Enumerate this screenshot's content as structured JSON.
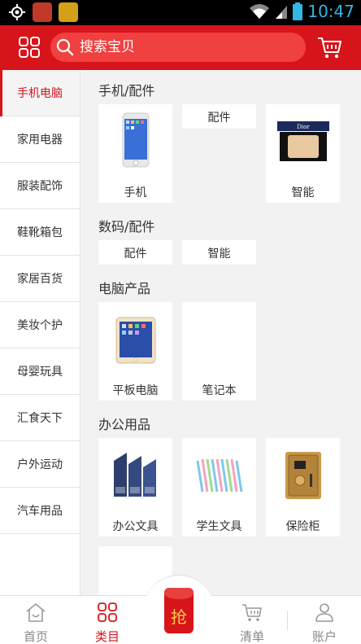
{
  "status_bar": {
    "time": "10:47"
  },
  "header": {
    "search_placeholder": "搜索宝贝"
  },
  "sidebar": {
    "items": [
      {
        "label": "手机电脑"
      },
      {
        "label": "家用电器"
      },
      {
        "label": "服装配饰"
      },
      {
        "label": "鞋靴箱包"
      },
      {
        "label": "家居百货"
      },
      {
        "label": "美妆个护"
      },
      {
        "label": "母婴玩具"
      },
      {
        "label": "汇食天下"
      },
      {
        "label": "户外运动"
      },
      {
        "label": "汽车用品"
      }
    ],
    "active_index": 0
  },
  "sections": [
    {
      "title": "手机/配件",
      "tiles": [
        {
          "label": "手机"
        },
        {
          "label": "配件"
        },
        {
          "label": "智能"
        }
      ]
    },
    {
      "title": "数码/配件",
      "tiles": [
        {
          "label": "配件"
        },
        {
          "label": "智能"
        }
      ]
    },
    {
      "title": "电脑产品",
      "tiles": [
        {
          "label": "平板电脑"
        },
        {
          "label": "笔记本"
        }
      ]
    },
    {
      "title": "办公用品",
      "tiles": [
        {
          "label": "办公文具"
        },
        {
          "label": "学生文具"
        },
        {
          "label": "保险柜"
        }
      ]
    }
  ],
  "bottom_nav": {
    "items": [
      {
        "label": "首页"
      },
      {
        "label": "类目"
      },
      {
        "label": "清单"
      },
      {
        "label": "账户"
      }
    ],
    "center_char": "抢"
  },
  "colors": {
    "accent": "#d7141a",
    "search_bg": "#f04040",
    "time": "#33b5e5"
  }
}
